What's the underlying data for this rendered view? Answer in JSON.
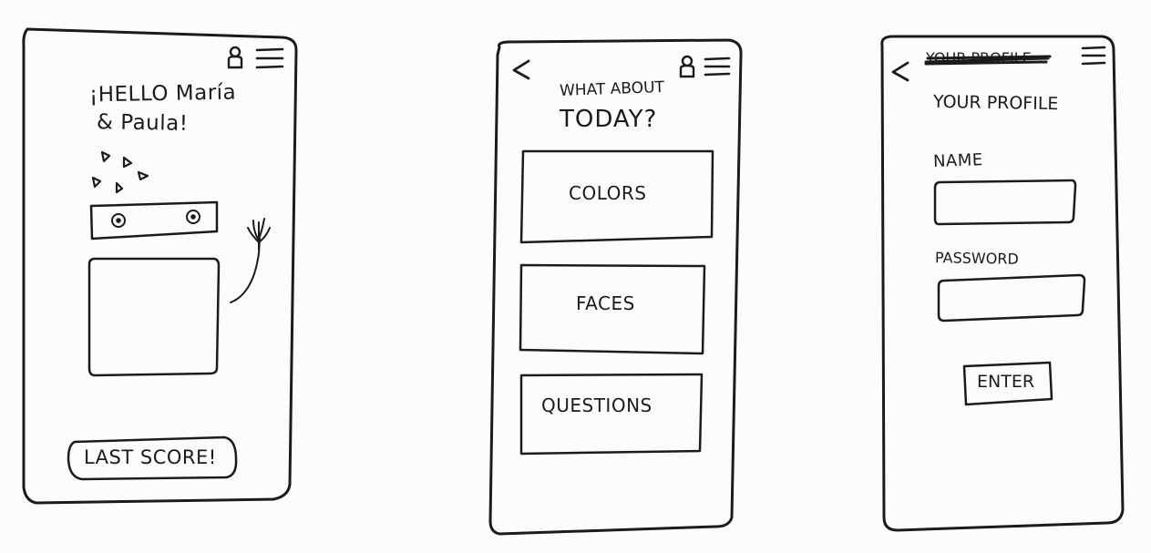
{
  "screens": {
    "home": {
      "greeting_line1": "¡HELLO María",
      "greeting_line2": "& Paula!",
      "last_score_label": "LAST SCORE!"
    },
    "categories": {
      "back_label": "<",
      "heading_line1": "WHAT ABOUT",
      "heading_line2": "TODAY?",
      "options": [
        {
          "label": "COLORS"
        },
        {
          "label": "FACES"
        },
        {
          "label": "QUESTIONS"
        }
      ]
    },
    "profile": {
      "back_label": "<",
      "struck_header": "YOUR PROFILE",
      "title": "YOUR PROFILE",
      "name_label": "NAME",
      "password_label": "PASSWORD",
      "enter_label": "ENTER"
    }
  },
  "icons": {
    "user": "user-icon",
    "menu": "menu-icon",
    "back": "back-arrow-icon",
    "hand": "hand-icon",
    "confetti": "confetti-icon",
    "eye": "eye-icon"
  },
  "colors": {
    "ink": "#1b1b1b",
    "paper": "#fcfcfb"
  }
}
